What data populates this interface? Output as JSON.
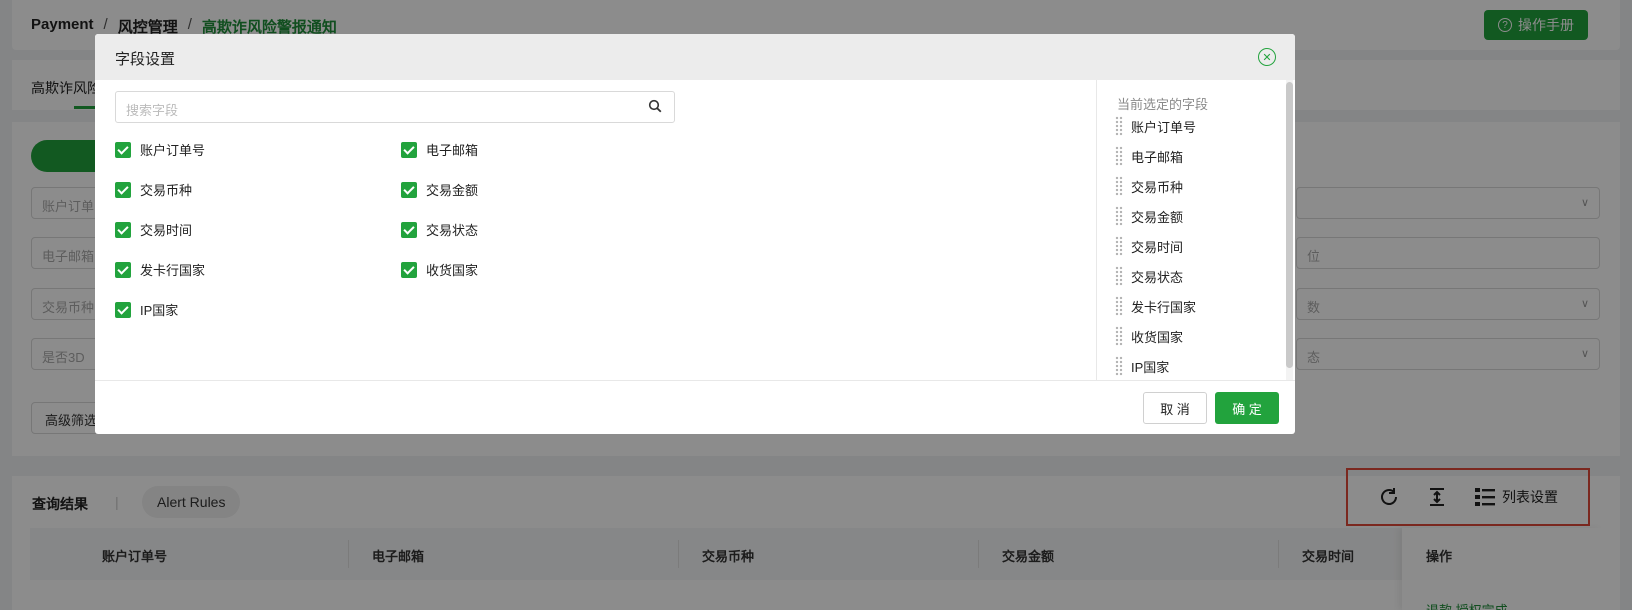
{
  "header": {
    "breadcrumb": [
      "Payment",
      "风控管理",
      "高欺诈风险警报通知"
    ],
    "separator": "/",
    "manual_button": "操作手册"
  },
  "tabs": {
    "active": "高欺诈风险"
  },
  "filters": {
    "inputs": [
      "账户订单",
      "电子邮箱",
      "交易币种",
      "是否3D"
    ],
    "right_inputs": [
      "",
      "位",
      "数",
      "态"
    ],
    "advanced": "高级筛选"
  },
  "results": {
    "title": "查询结果",
    "divider": "|",
    "alert_rules": "Alert Rules",
    "toolbar": {
      "column_settings": "列表设置"
    },
    "columns": [
      "账户订单号",
      "电子邮箱",
      "交易币种",
      "交易金额",
      "交易时间"
    ],
    "op_column": "操作",
    "op_link": "退款  授权完成"
  },
  "modal": {
    "title": "字段设置",
    "search_placeholder": "搜索字段",
    "fields": [
      {
        "label": "账户订单号",
        "checked": true
      },
      {
        "label": "电子邮箱",
        "checked": true
      },
      {
        "label": "交易币种",
        "checked": true
      },
      {
        "label": "交易金额",
        "checked": true
      },
      {
        "label": "交易时间",
        "checked": true
      },
      {
        "label": "交易状态",
        "checked": true
      },
      {
        "label": "发卡行国家",
        "checked": true
      },
      {
        "label": "收货国家",
        "checked": true
      },
      {
        "label": "IP国家",
        "checked": true
      }
    ],
    "selected_title": "当前选定的字段",
    "selected": [
      "账户订单号",
      "电子邮箱",
      "交易币种",
      "交易金额",
      "交易时间",
      "交易状态",
      "发卡行国家",
      "收货国家",
      "IP国家"
    ],
    "cancel": "取 消",
    "confirm": "确 定"
  }
}
